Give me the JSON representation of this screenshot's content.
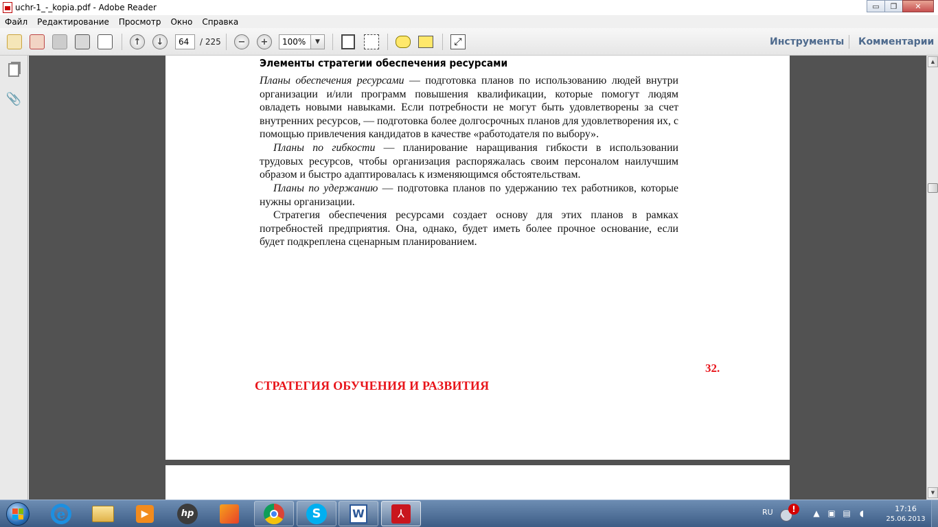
{
  "window": {
    "title": "uchr-1_-_kopia.pdf - Adobe Reader",
    "minimize": "▭",
    "maximize": "❐",
    "close": "✕"
  },
  "menu": [
    "Файл",
    "Редактирование",
    "Просмотр",
    "Окно",
    "Справка"
  ],
  "toolbar": {
    "page_number": "64",
    "page_total": "/ 225",
    "zoom": "100%",
    "zoom_arrow": "▼",
    "tools_label": "Инструменты",
    "comments_label": "Комментарии",
    "prev_page": "↑",
    "next_page": "↓",
    "zoom_out": "−",
    "zoom_in": "+",
    "expand": "⤢"
  },
  "document": {
    "heading": "Элементы стратегии обеспечения ресурсами",
    "p1_term": "Планы обеспечения ресурсами",
    "p1_text": " — подготовка планов по использованию людей внутри организации и/или программ повышения квалификации, которые помогут людям овладеть новыми навыками. Если потребности не могут быть удовлетворены за счет внутренних ресурсов, — подготовка более долгосрочных планов для удовлетворения их, с помощью привлечения кандидатов в качестве «работодателя по выбору».",
    "p2_term": "Планы по гибкости",
    "p2_text": " — планирование наращивания гибкости в использовании трудовых ресурсов, чтобы организация распоряжалась своим персоналом наилучшим образом и быстро адаптировалась к изменяющимся обстоятельствам.",
    "p3_term": "Планы по удержанию",
    "p3_text": " — подготовка планов по удержанию тех работников, которые нужны организации.",
    "p4_text": "Стратегия обеспечения ресурсами создает основу для этих планов в рамках потребностей предприятия. Она, однако, будет иметь более прочное основание, если будет подкреплена сценарным планированием.",
    "section_number": "32.",
    "section_title": "СТРАТЕГИЯ ОБУЧЕНИЯ И РАЗВИТИЯ"
  },
  "scrollbar": {
    "up": "▲",
    "down": "▼"
  },
  "taskbar": {
    "ie_glyph": "e",
    "hp_glyph": "hp",
    "skype_glyph": "S",
    "word_glyph": "W",
    "media_glyph": "▶",
    "adobe_glyph": "⅄",
    "alert_glyph": "!",
    "language": "RU",
    "time": "17:16",
    "date": "25.06.2013"
  },
  "colors": {
    "section_red": "#e8151b",
    "toolbar_link": "#4e6a8d",
    "doc_background": "#525252"
  }
}
